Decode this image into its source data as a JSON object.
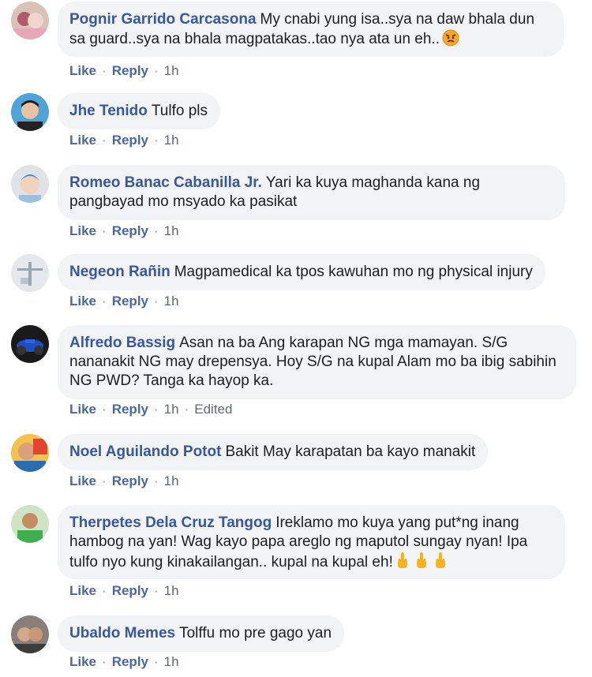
{
  "actions": {
    "like": "Like",
    "reply": "Reply",
    "separator": "·",
    "edited": "Edited"
  },
  "comments": [
    {
      "author": "Pognir Garrido Carcasona",
      "text": "My cnabi yung isa..sya na daw bhala dun sa guard..sya na bhala magpatakas..tao nya ata un eh..",
      "time": "1h",
      "emoji": "angry-face-icon"
    },
    {
      "author": "Jhe Tenido",
      "text": "Tulfo pls",
      "time": "1h"
    },
    {
      "author": "Romeo Banac Cabanilla Jr.",
      "text": "Yari ka kuya maghanda kana ng pangbayad mo msyado ka pasikat",
      "time": "1h"
    },
    {
      "author": "Negeon Rañin",
      "text": "Magpamedical ka tpos kawuhan mo ng physical injury",
      "time": "1h"
    },
    {
      "author": "Alfredo Bassig",
      "text": "Asan na ba Ang karapan NG mga mamayan. S/G nananakit NG may drepensya. Hoy S/G na kupal Alam mo ba ibig sabihin NG PWD? Tanga ka hayop ka.",
      "time": "1h",
      "edited": true
    },
    {
      "author": "Noel Aguilando Potot",
      "text": "Bakit May karapatan ba kayo manakit",
      "time": "1h"
    },
    {
      "author": "Therpetes Dela Cruz Tangog",
      "text": "Ireklamo mo kuya yang put*ng inang hambog na yan! Wag kayo papa areglo ng maputol sungay nyan! Ipa tulfo nyo kung kinakailangan.. kupal na kupal eh!",
      "time": "1h",
      "emoji": "middle-finger-icon x3"
    },
    {
      "author": "Ubaldo Memes",
      "text": "Tolffu mo pre gago yan",
      "time": "1h"
    }
  ],
  "colors": {
    "author": "#385898",
    "bubble_bg": "#f2f3f5",
    "action_link": "#4b67a1",
    "meta": "#616770"
  }
}
